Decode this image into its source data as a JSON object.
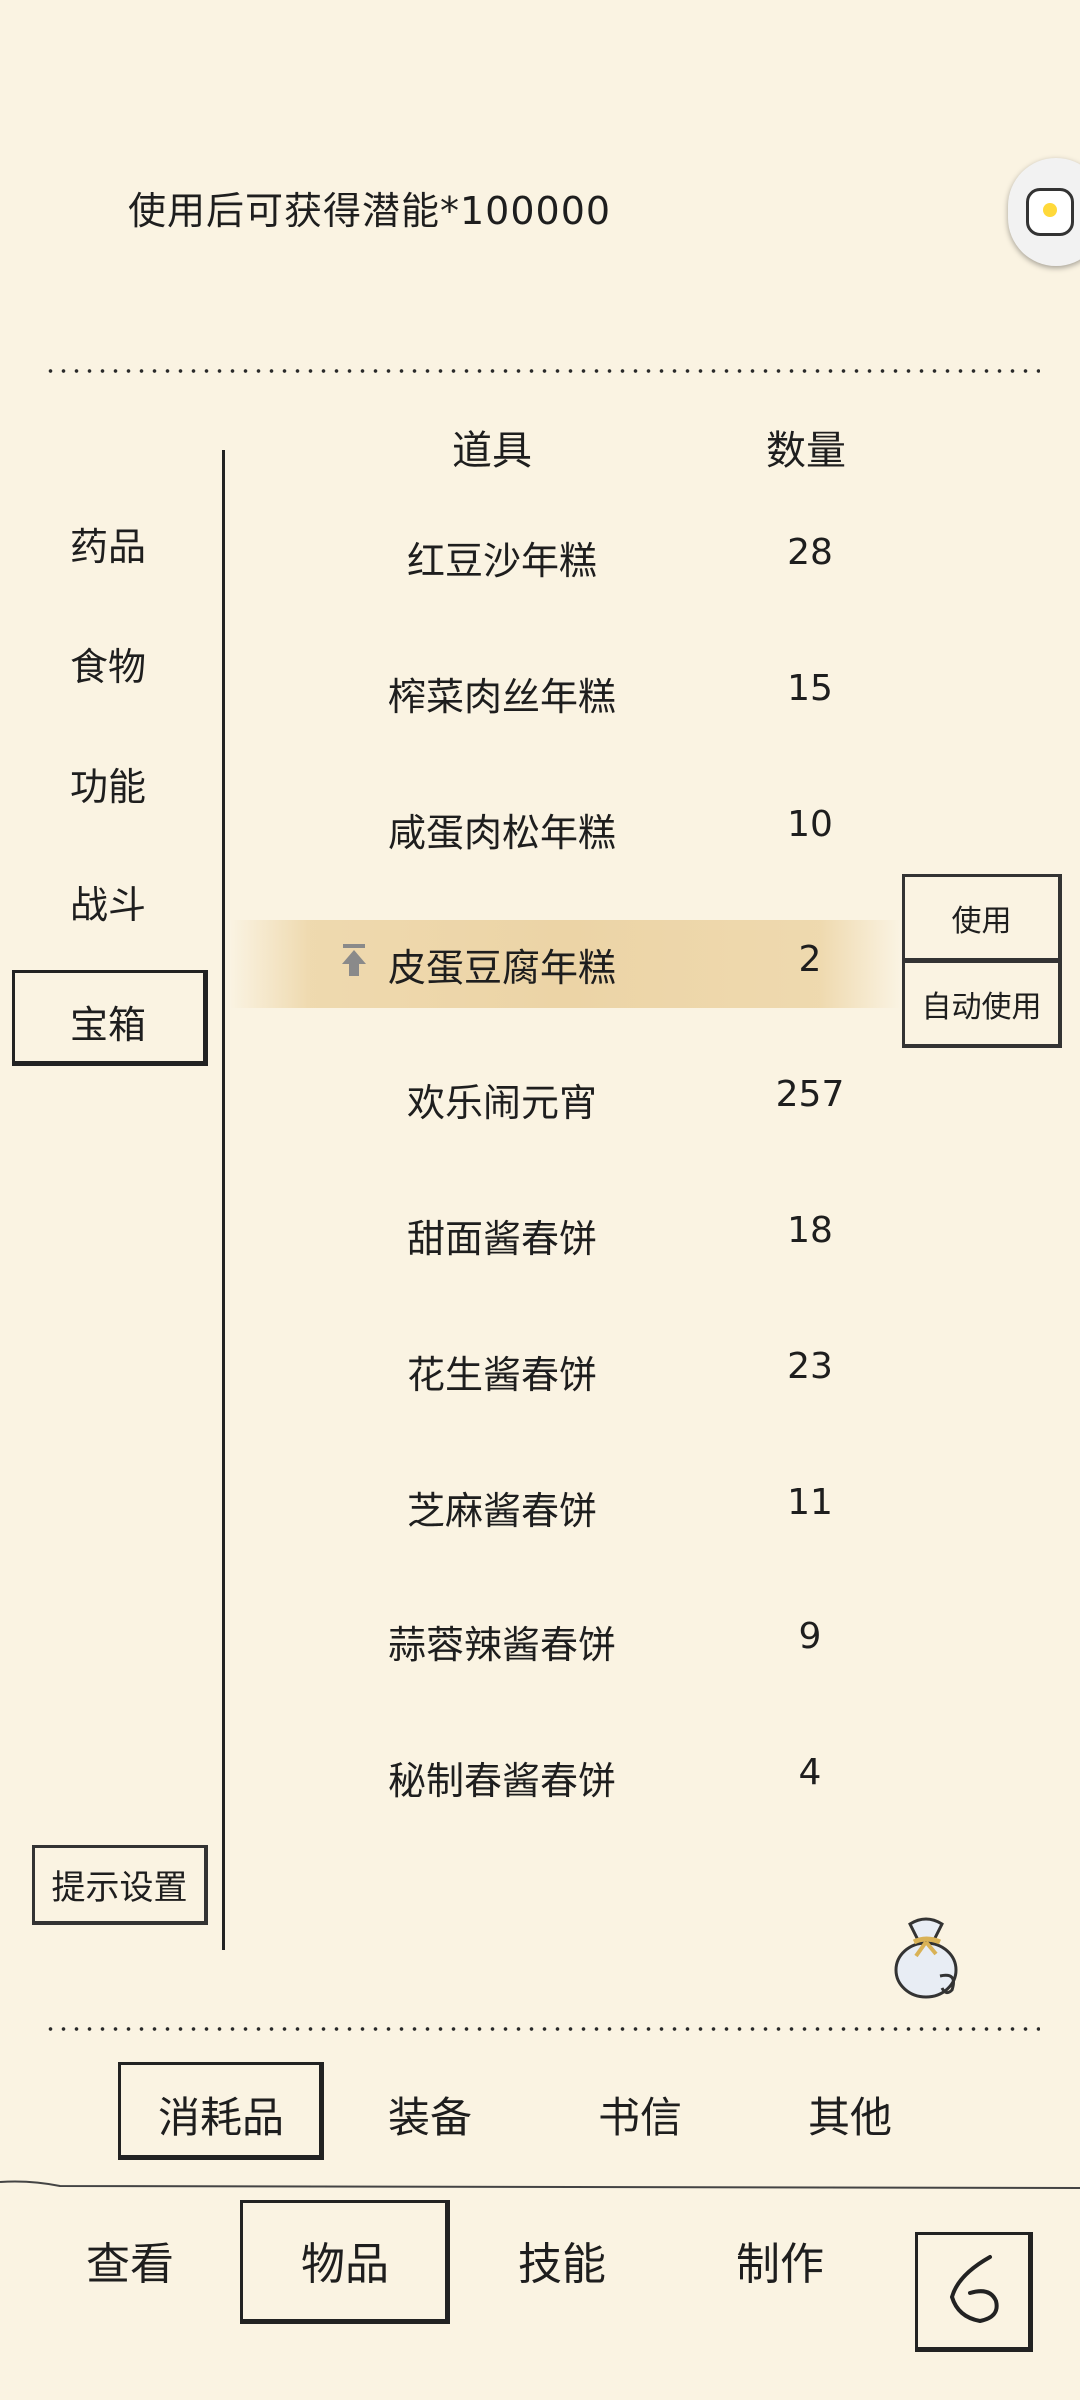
{
  "description": "使用后可获得潜能*100000",
  "categories": [
    "药品",
    "食物",
    "功能",
    "战斗",
    "宝箱"
  ],
  "active_category": "宝箱",
  "hint_settings_label": "提示设置",
  "table": {
    "header_item": "道具",
    "header_qty": "数量",
    "rows": [
      {
        "name": "红豆沙年糕",
        "qty": "28"
      },
      {
        "name": "榨菜肉丝年糕",
        "qty": "15"
      },
      {
        "name": "咸蛋肉松年糕",
        "qty": "10"
      },
      {
        "name": "皮蛋豆腐年糕",
        "qty": "2"
      },
      {
        "name": "欢乐闹元宵",
        "qty": "257"
      },
      {
        "name": "甜面酱春饼",
        "qty": "18"
      },
      {
        "name": "花生酱春饼",
        "qty": "23"
      },
      {
        "name": "芝麻酱春饼",
        "qty": "11"
      },
      {
        "name": "蒜蓉辣酱春饼",
        "qty": "9"
      },
      {
        "name": "秘制春酱春饼",
        "qty": "4"
      }
    ],
    "selected_row": "皮蛋豆腐年糕"
  },
  "actions": {
    "use": "使用",
    "auto_use": "自动使用"
  },
  "bottom_tabs": [
    "消耗品",
    "装备",
    "书信",
    "其他"
  ],
  "active_bottom_tab": "消耗品",
  "nav": [
    "查看",
    "物品",
    "技能",
    "制作"
  ],
  "active_nav": "物品",
  "icons": {
    "floating": "gamepad-icon",
    "pin": "pin-top-icon",
    "bag": "item-bag-icon",
    "back": "back-arrow-icon"
  },
  "colors": {
    "background": "#faf3e2",
    "highlight": "#ecd4a6",
    "ink": "#1e1e1e"
  }
}
